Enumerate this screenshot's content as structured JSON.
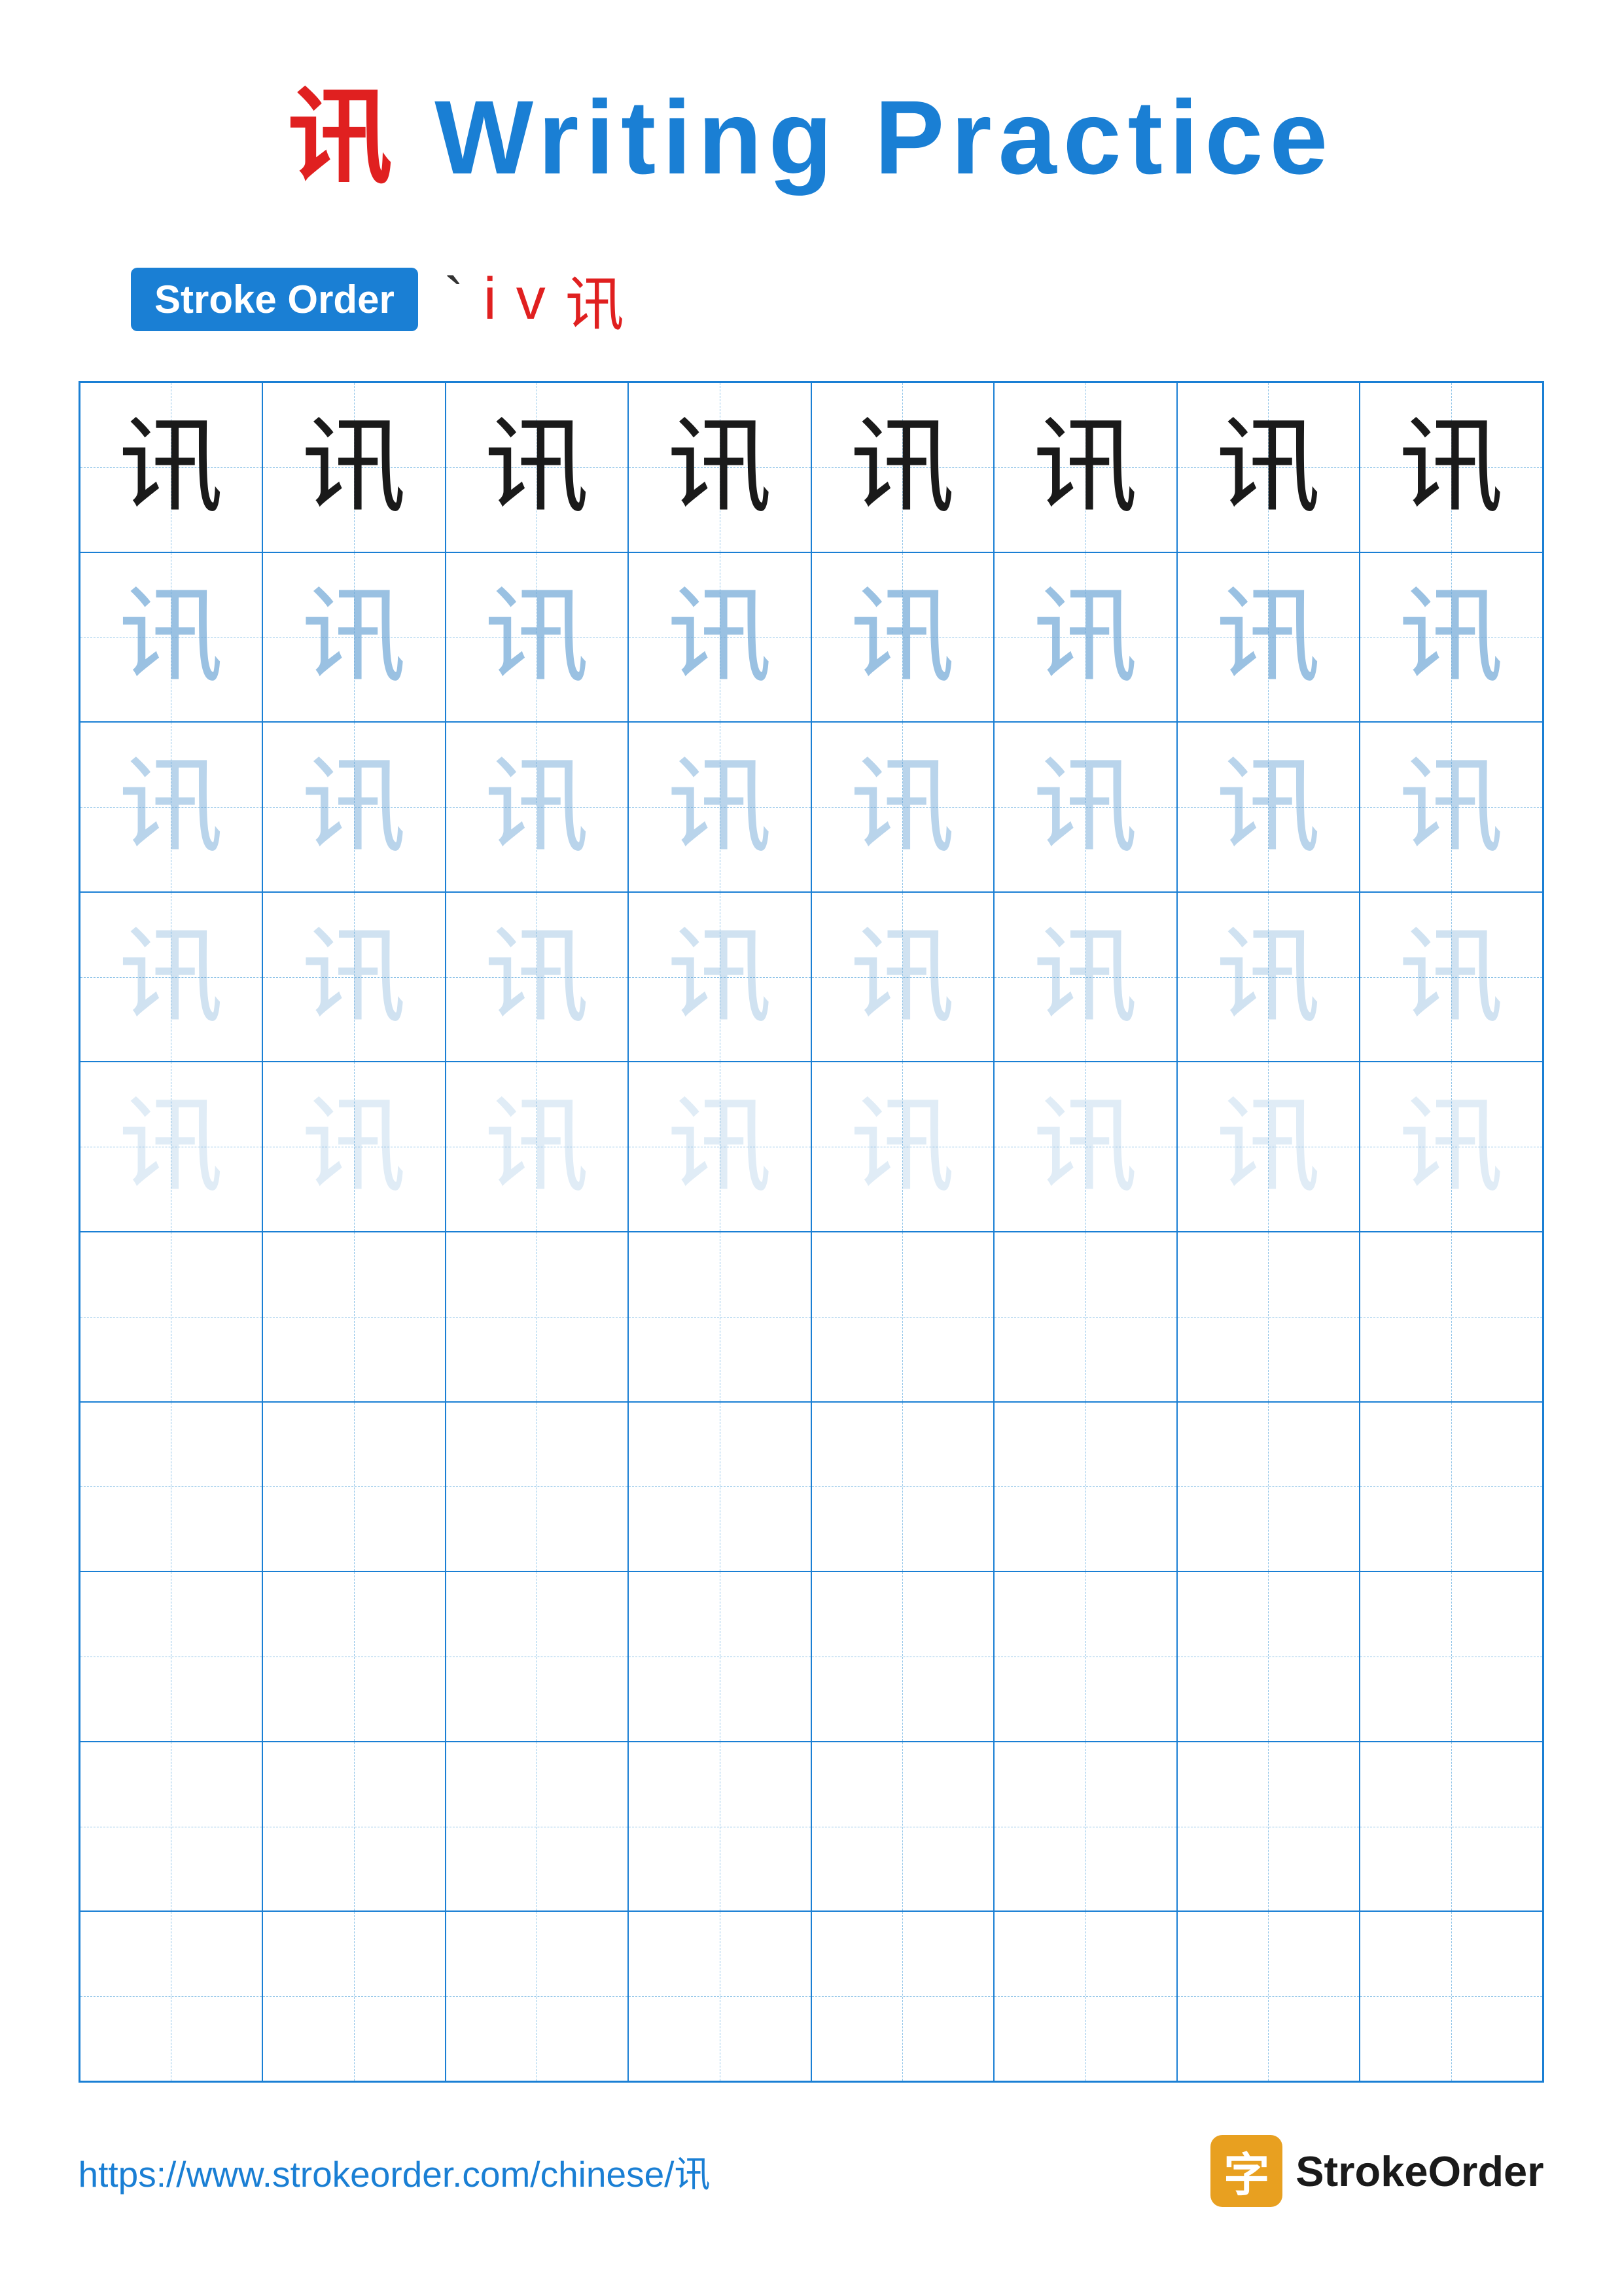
{
  "title": {
    "prefix_char": "讯",
    "suffix": " Writing Practice"
  },
  "stroke_order": {
    "badge_label": "Stroke Order",
    "strokes": [
      "`",
      "i",
      "v",
      "讯"
    ]
  },
  "grid": {
    "rows": 10,
    "cols": 8,
    "char": "讯",
    "row_styles": [
      "dark",
      "light-1",
      "light-2",
      "light-3",
      "light-4",
      "empty",
      "empty",
      "empty",
      "empty",
      "empty"
    ]
  },
  "footer": {
    "url": "https://www.strokeorder.com/chinese/讯",
    "logo_icon": "字",
    "logo_text": "StrokeOrder"
  }
}
